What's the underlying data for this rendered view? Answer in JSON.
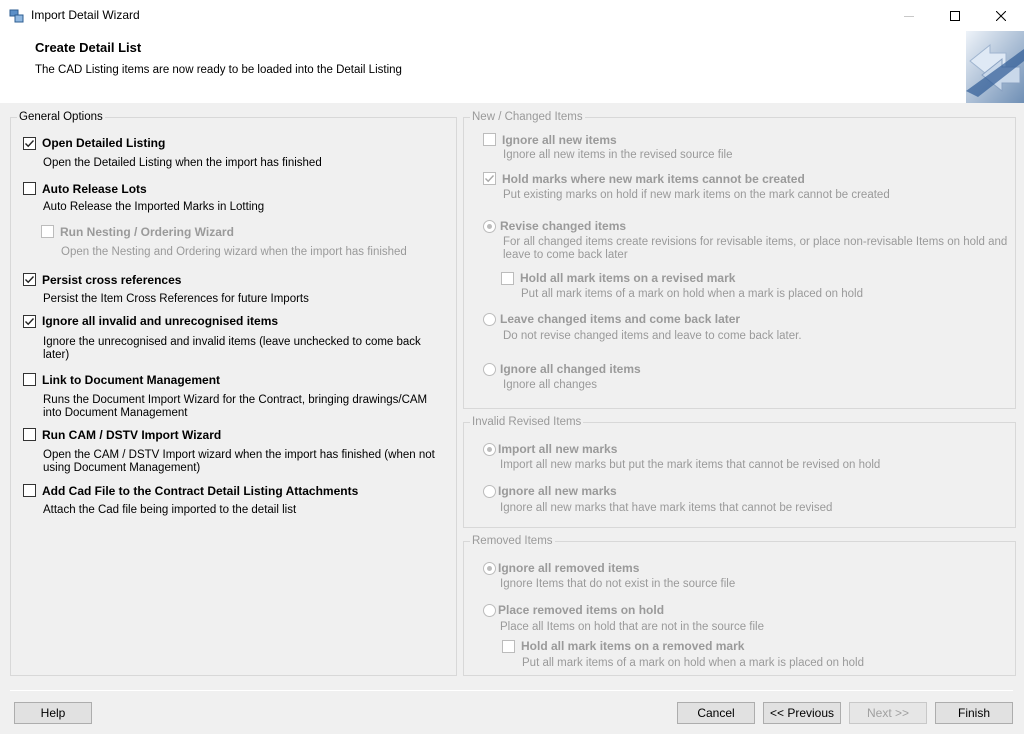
{
  "window": {
    "title": "Import Detail Wizard",
    "minimize_icon": "minimize-icon",
    "maximize_icon": "maximize-icon",
    "close_icon": "close-icon"
  },
  "header": {
    "title": "Create Detail List",
    "subtitle": "The CAD Listing items are now ready to be loaded into the Detail Listing"
  },
  "general": {
    "label": "General Options",
    "items": [
      {
        "label": "Open Detailed Listing",
        "desc": "Open the Detailed Listing when the import has finished",
        "checked": true
      },
      {
        "label": "Auto Release Lots",
        "desc": "Auto Release the Imported Marks in Lotting",
        "checked": false
      },
      {
        "label": "Run Nesting / Ordering Wizard",
        "desc": "Open the Nesting and Ordering wizard when the import has finished",
        "checked": false
      },
      {
        "label": "Persist cross references",
        "desc": "Persist the Item Cross References for future Imports",
        "checked": true
      },
      {
        "label": "Ignore all invalid and unrecognised items",
        "desc": "Ignore the unrecognised and invalid items (leave unchecked to come back later)",
        "checked": true
      },
      {
        "label": "Link to Document Management",
        "desc": "Runs the Document Import Wizard for the Contract, bringing drawings/CAM into Document Management",
        "checked": false
      },
      {
        "label": "Run CAM / DSTV Import Wizard",
        "desc": "Open the CAM / DSTV Import wizard when the import has finished (when not using Document Management)",
        "checked": false
      },
      {
        "label": "Add Cad File to the Contract Detail Listing Attachments",
        "desc": "Attach the Cad file being imported to the detail list",
        "checked": false
      }
    ]
  },
  "new_changed": {
    "label": "New / Changed Items",
    "items": [
      {
        "label": "Ignore all new items",
        "desc": "Ignore all new items in the revised source file"
      },
      {
        "label": "Hold marks where new mark items cannot be created",
        "desc": "Put existing marks on hold if new mark items on the mark cannot be created"
      },
      {
        "label": "Revise changed items",
        "desc": "For all changed items create revisions for revisable items, or place non-revisable Items on hold and leave to come back later"
      },
      {
        "label": "Hold all mark items on a revised mark",
        "desc": "Put all mark items of a mark on hold when a mark is placed on hold"
      },
      {
        "label": "Leave changed items and come back later",
        "desc": "Do not revise changed items and leave to come back later."
      },
      {
        "label": "Ignore all changed items",
        "desc": "Ignore all changes"
      }
    ]
  },
  "invalid_revised": {
    "label": "Invalid Revised Items",
    "items": [
      {
        "label": "Import all new marks",
        "desc": "Import all new marks but put the mark items that cannot be revised on hold"
      },
      {
        "label": "Ignore all new marks",
        "desc": "Ignore all new marks that have mark items that cannot be revised"
      }
    ]
  },
  "removed": {
    "label": "Removed Items",
    "items": [
      {
        "label": "Ignore all removed items",
        "desc": "Ignore Items that do not exist in the source file"
      },
      {
        "label": "Place removed items on hold",
        "desc": "Place all Items on hold that are not in the source file"
      },
      {
        "label": "Hold all mark items on a removed mark",
        "desc": "Put all mark items of a mark on hold when a mark is placed on hold"
      }
    ]
  },
  "buttons": {
    "help": "Help",
    "cancel": "Cancel",
    "previous": "<< Previous",
    "next": "Next >>",
    "finish": "Finish"
  }
}
